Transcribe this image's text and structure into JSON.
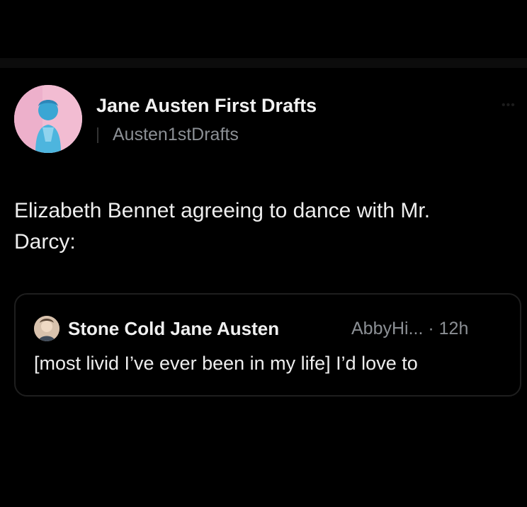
{
  "tweet": {
    "author_name": "Jane Austen First Drafts",
    "author_handle": "Austen1stDrafts",
    "more_icon": "more-horizontal-icon",
    "text_line1": "Elizabeth Bennet agreeing to dance with Mr.",
    "text_line2": "Darcy:"
  },
  "quote": {
    "author_name": "Stone Cold Jane Austen",
    "meta": "AbbyHi... · 12h",
    "text": "[most livid I’ve ever been in my life] I’d love to"
  },
  "colors": {
    "background": "#000000",
    "primary_text": "#e7e9ea",
    "secondary_text": "#8b8f94",
    "card_border": "#1e1e1e"
  }
}
